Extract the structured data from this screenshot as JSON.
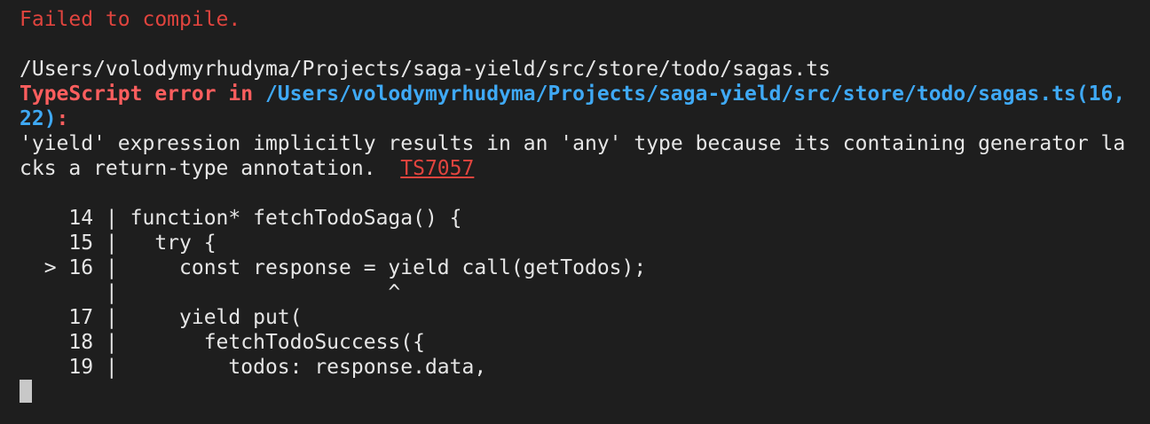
{
  "terminal": {
    "header": "Failed to compile.",
    "file_path": "/Users/volodymyrhudyma/Projects/saga-yield/src/store/todo/sagas.ts",
    "error_label": "TypeScript error in ",
    "error_location_line1": "/Users/volodymyrhudyma/Projects/saga-yield/src/store/todo/sagas.ts(16,",
    "error_location_line2": "22)",
    "error_colon": ":",
    "message_line1": "'yield' expression implicitly results in an 'any' type because its containing generator la",
    "message_line2": "cks a return-type annotation.  ",
    "error_code": "TS7057",
    "code_lines": [
      {
        "prefix": "    14 | ",
        "code": "function* fetchTodoSaga() {"
      },
      {
        "prefix": "    15 | ",
        "code": "  try {"
      },
      {
        "prefix": "  > 16 | ",
        "code": "    const response = yield call(getTodos);"
      },
      {
        "prefix": "       | ",
        "code": "                     ^"
      },
      {
        "prefix": "    17 | ",
        "code": "    yield put("
      },
      {
        "prefix": "    18 | ",
        "code": "      fetchTodoSuccess({"
      },
      {
        "prefix": "    19 | ",
        "code": "        todos: response.data,"
      }
    ]
  }
}
